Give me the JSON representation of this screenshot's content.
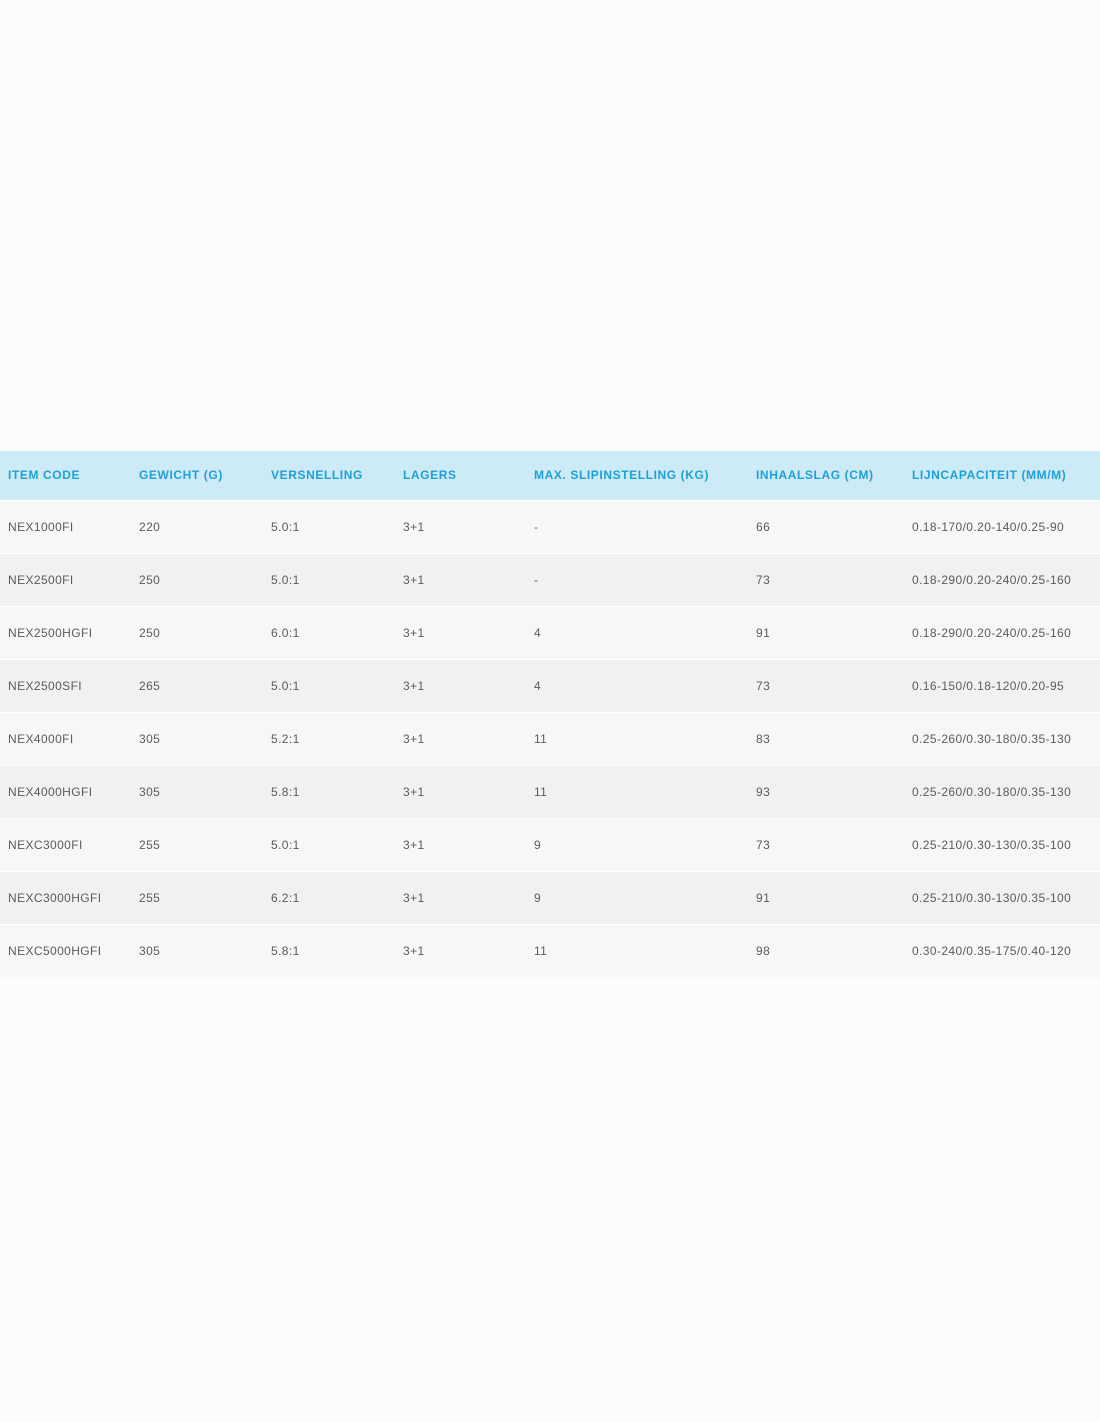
{
  "table": {
    "headers": [
      "ITEM CODE",
      "GEWICHT (G)",
      "VERSNELLING",
      "LAGERS",
      "MAX. SLIPINSTELLING (KG)",
      "INHAALSLAG (CM)",
      "LIJNCAPACITEIT (MM/M)"
    ],
    "rows": [
      [
        "NEX1000FI",
        "220",
        "5.0:1",
        "3+1",
        "-",
        "66",
        "0.18-170/0.20-140/0.25-90"
      ],
      [
        "NEX2500FI",
        "250",
        "5.0:1",
        "3+1",
        "-",
        "73",
        "0.18-290/0.20-240/0.25-160"
      ],
      [
        "NEX2500HGFI",
        "250",
        "6.0:1",
        "3+1",
        "4",
        "91",
        "0.18-290/0.20-240/0.25-160"
      ],
      [
        "NEX2500SFI",
        "265",
        "5.0:1",
        "3+1",
        "4",
        "73",
        "0.16-150/0.18-120/0.20-95"
      ],
      [
        "NEX4000FI",
        "305",
        "5.2:1",
        "3+1",
        "11",
        "83",
        "0.25-260/0.30-180/0.35-130"
      ],
      [
        "NEX4000HGFI",
        "305",
        "5.8:1",
        "3+1",
        "11",
        "93",
        "0.25-260/0.30-180/0.35-130"
      ],
      [
        "NEXC3000FI",
        "255",
        "5.0:1",
        "3+1",
        "9",
        "73",
        "0.25-210/0.30-130/0.35-100"
      ],
      [
        "NEXC3000HGFI",
        "255",
        "6.2:1",
        "3+1",
        "9",
        "91",
        "0.25-210/0.30-130/0.35-100"
      ],
      [
        "NEXC5000HGFI",
        "305",
        "5.8:1",
        "3+1",
        "11",
        "98",
        "0.30-240/0.35-175/0.40-120"
      ]
    ]
  },
  "colors": {
    "header_background": "#cdeaf7",
    "header_text": "#1fa0d6",
    "row_odd": "#f7f7f8",
    "row_even": "#f1f1f2",
    "cell_text": "#5b5b5b"
  }
}
